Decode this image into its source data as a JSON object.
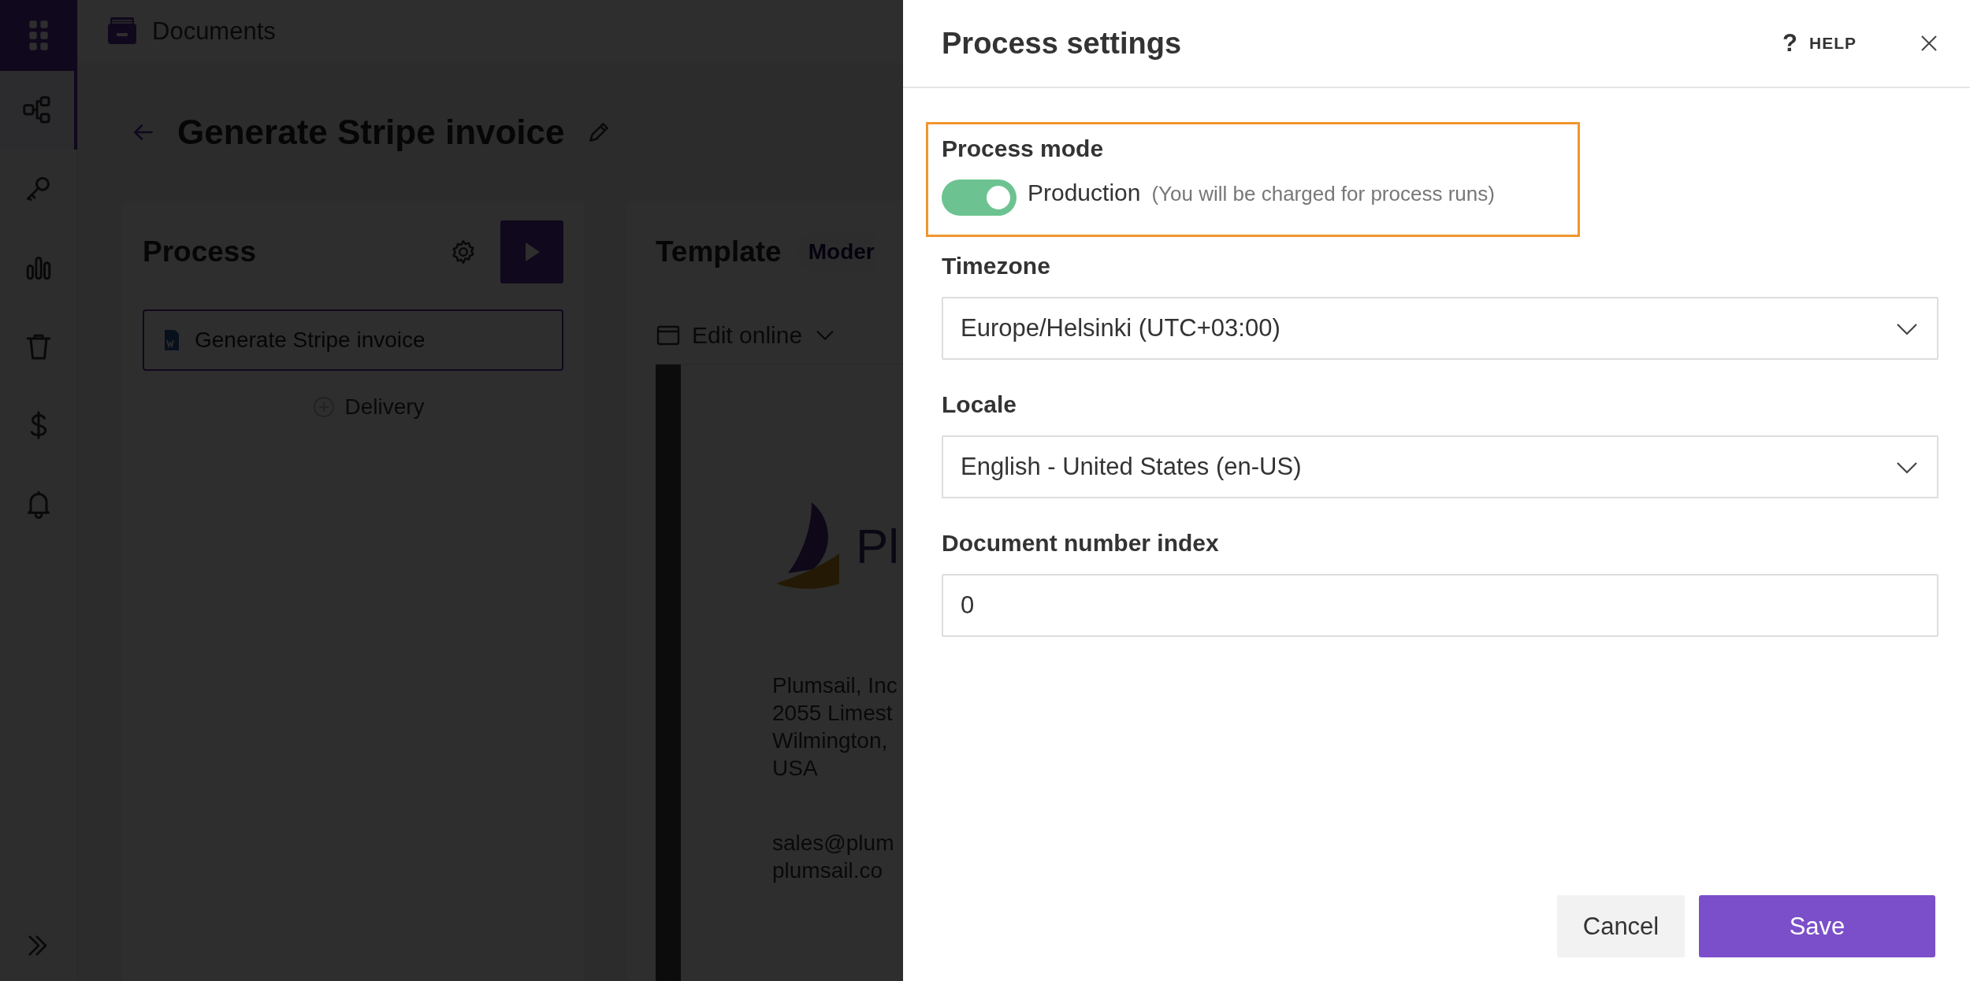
{
  "sidebar": {
    "items": [
      {
        "selected": true
      },
      {
        "selected": false
      },
      {
        "selected": false
      },
      {
        "selected": false
      },
      {
        "selected": false
      },
      {
        "selected": false
      }
    ]
  },
  "header": {
    "title": "Documents"
  },
  "page": {
    "title": "Generate Stripe invoice"
  },
  "process": {
    "heading": "Process",
    "steps": [
      {
        "label": "Generate Stripe invoice"
      }
    ],
    "add_label": "Delivery"
  },
  "template": {
    "heading": "Template",
    "tag": "Moder",
    "toolbar": {
      "label": "Edit online"
    },
    "preview": {
      "logo_text": "Pl",
      "address_lines": [
        "Plumsail, Inc",
        "2055 Limest",
        "Wilmington,",
        "USA"
      ],
      "contact_lines": [
        "sales@plum",
        "plumsail.co"
      ]
    }
  },
  "settings": {
    "title": "Process settings",
    "help_icon": "?",
    "help": "HELP",
    "process_mode": {
      "label": "Process mode",
      "on": true,
      "value": "Production",
      "note": "(You will be charged for process runs)",
      "highlighted": true
    },
    "fields": [
      {
        "kind": "select",
        "label": "Timezone",
        "value": "Europe/Helsinki (UTC+03:00)"
      },
      {
        "kind": "select",
        "label": "Locale",
        "value": "English - United States (en-US)"
      },
      {
        "kind": "input",
        "label": "Document number index",
        "value": "0"
      }
    ],
    "buttons": [
      {
        "kind": "secondary",
        "label": "Cancel"
      },
      {
        "kind": "primary",
        "label": "Save"
      }
    ]
  }
}
